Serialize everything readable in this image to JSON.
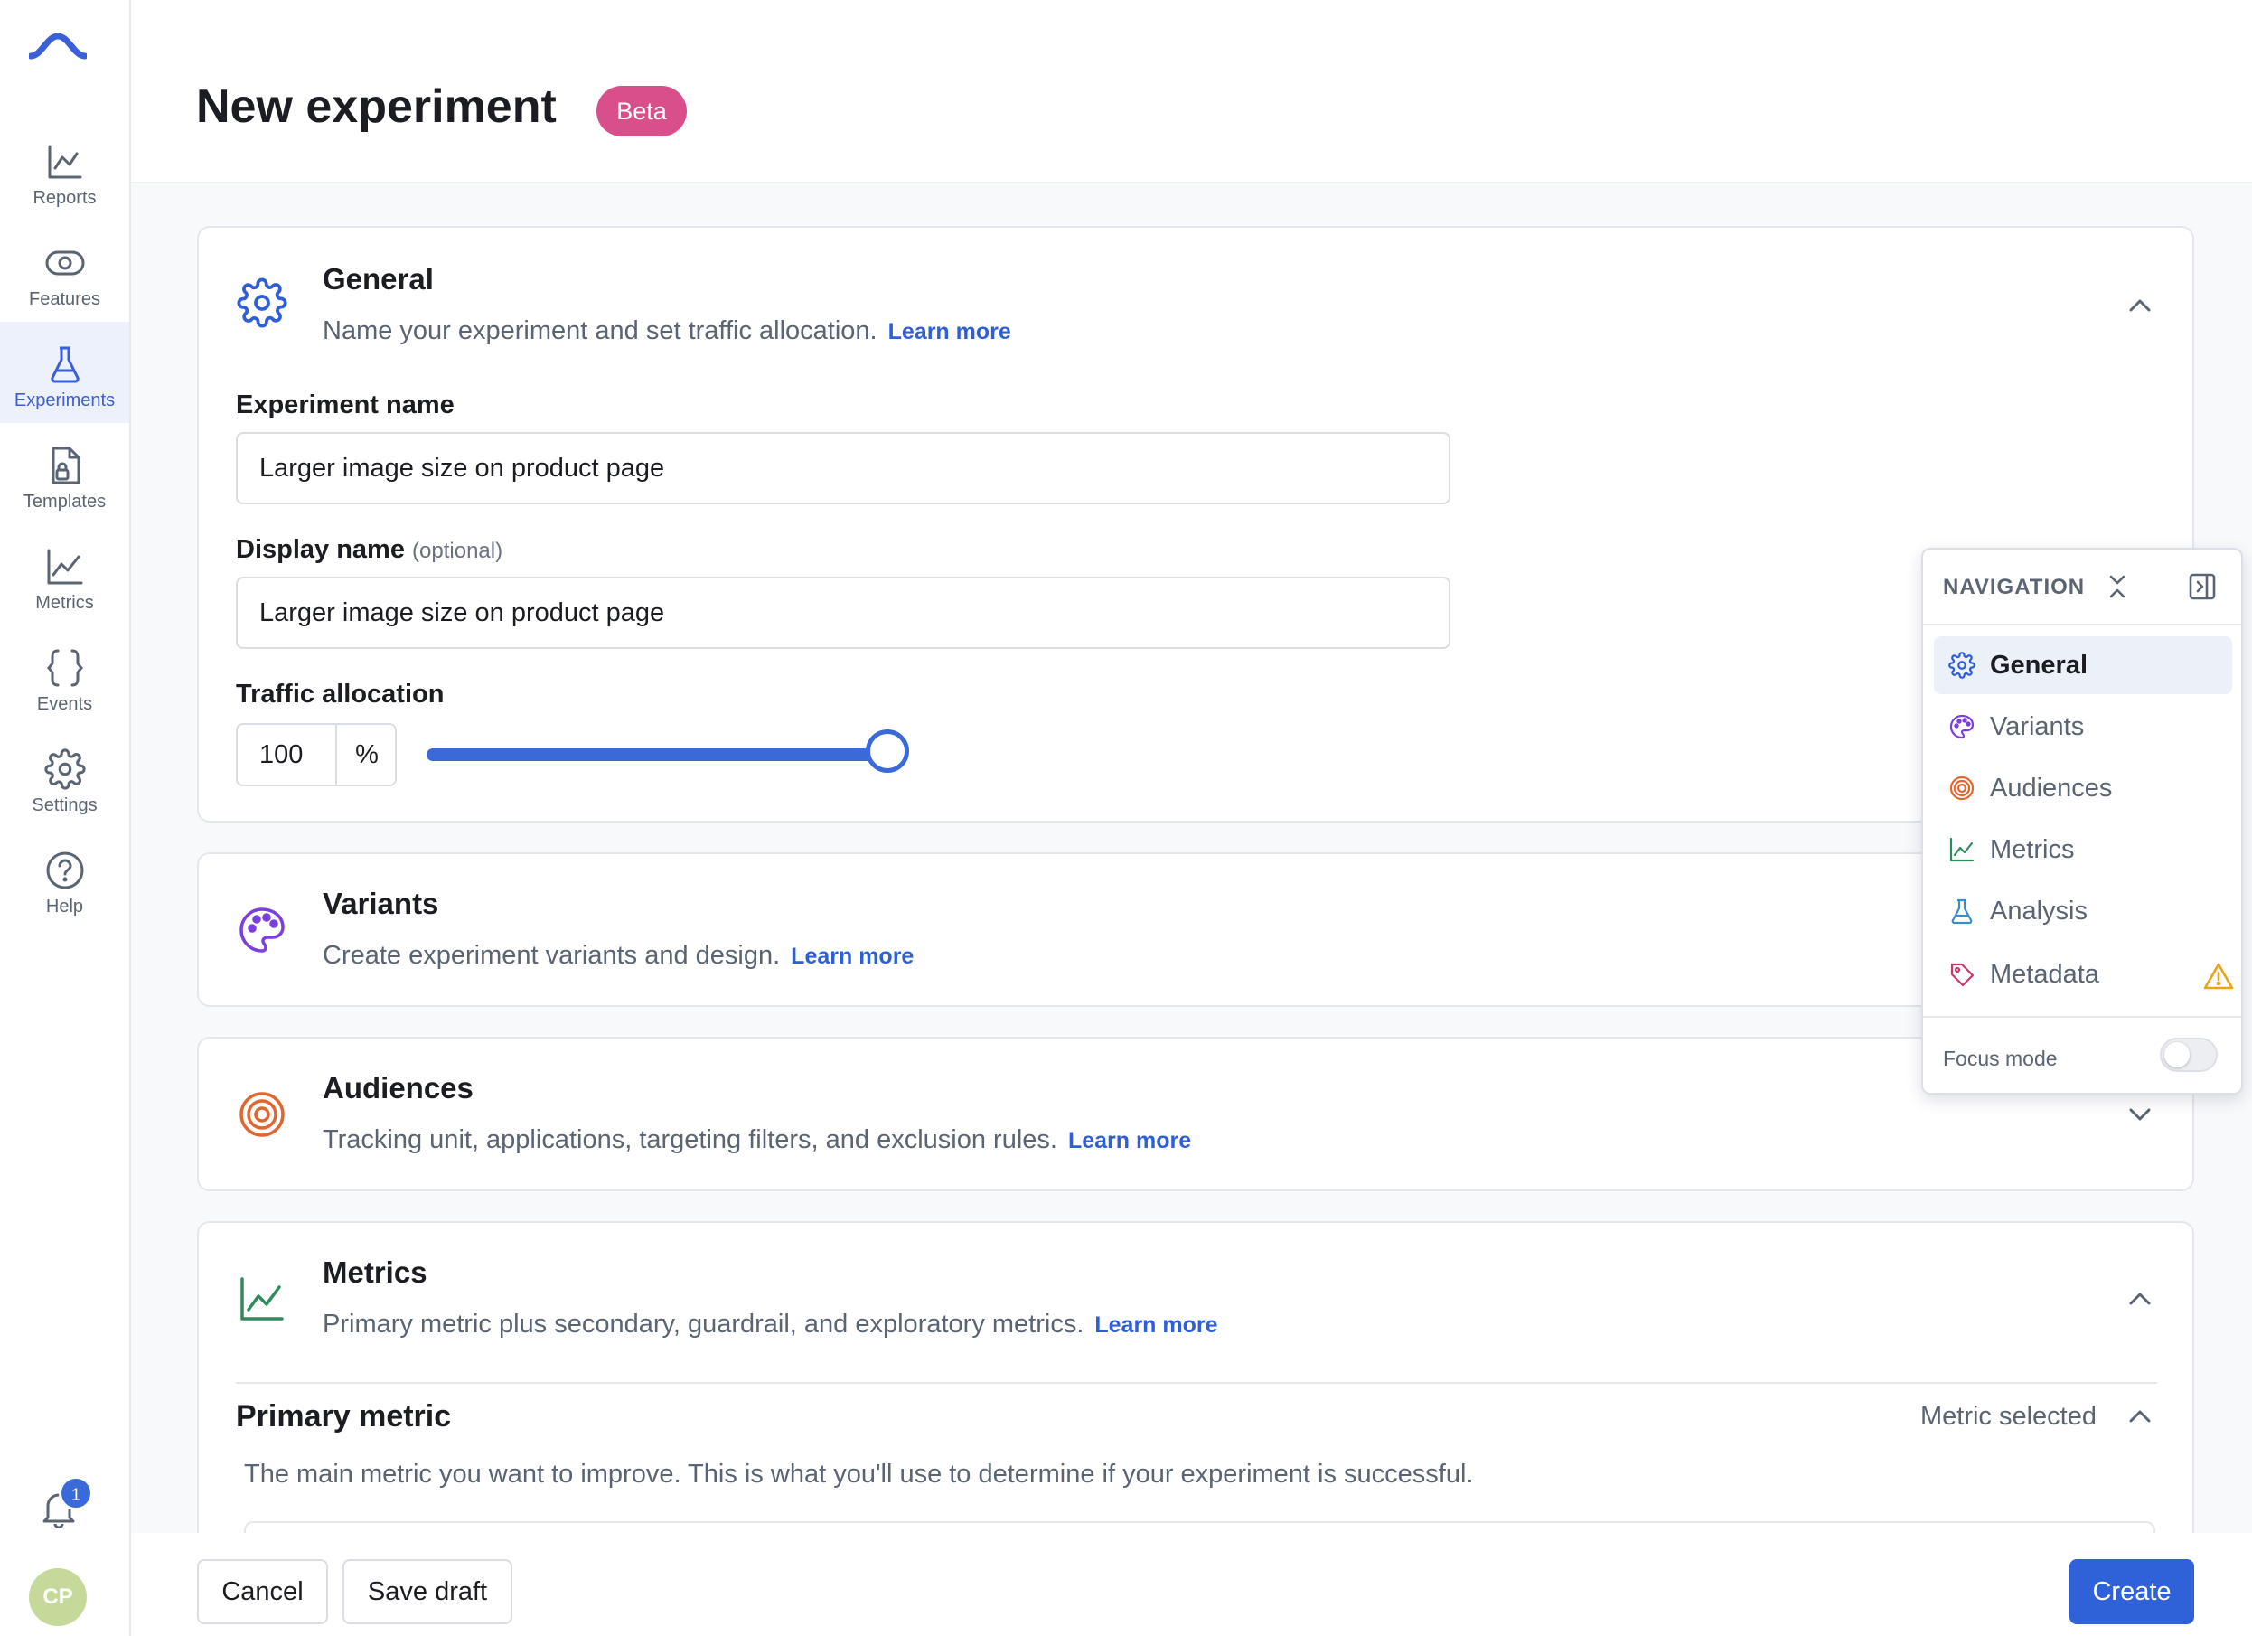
{
  "sidebar": {
    "items": [
      {
        "label": "Reports",
        "icon": "reports-icon"
      },
      {
        "label": "Features",
        "icon": "features-icon"
      },
      {
        "label": "Experiments",
        "icon": "flask-icon",
        "active": true
      },
      {
        "label": "Templates",
        "icon": "templates-icon"
      },
      {
        "label": "Metrics",
        "icon": "metrics-icon"
      },
      {
        "label": "Events",
        "icon": "braces-icon"
      },
      {
        "label": "Settings",
        "icon": "gear-icon"
      },
      {
        "label": "Help",
        "icon": "help-icon"
      }
    ],
    "notification_count": "1",
    "avatar_initials": "CP"
  },
  "header": {
    "title": "New experiment",
    "badge": "Beta"
  },
  "general": {
    "title": "General",
    "description": "Name your experiment and set traffic allocation.",
    "learn_more": "Learn more",
    "experiment_name_label": "Experiment name",
    "experiment_name_value": "Larger image size on product page",
    "display_name_label": "Display name",
    "display_name_optional": "(optional)",
    "display_name_value": "Larger image size on product page",
    "traffic_label": "Traffic allocation",
    "traffic_value": "100",
    "traffic_unit": "%",
    "traffic_fraction": 1.0
  },
  "variants": {
    "title": "Variants",
    "description": "Create experiment variants and design.",
    "learn_more": "Learn more"
  },
  "audiences": {
    "title": "Audiences",
    "description": "Tracking unit, applications, targeting filters, and exclusion rules.",
    "learn_more": "Learn more"
  },
  "metrics": {
    "title": "Metrics",
    "description": "Primary metric plus secondary, guardrail, and exploratory metrics.",
    "learn_more": "Learn more",
    "primary_title": "Primary metric",
    "primary_status": "Metric selected",
    "primary_description": "The main metric you want to improve. This is what you'll use to determine if your experiment is successful."
  },
  "footer": {
    "cancel": "Cancel",
    "save_draft": "Save draft",
    "create": "Create"
  },
  "navigation": {
    "heading": "NAVIGATION",
    "items": [
      {
        "label": "General",
        "icon": "gear-icon",
        "active": true
      },
      {
        "label": "Variants",
        "icon": "palette-icon"
      },
      {
        "label": "Audiences",
        "icon": "target-icon"
      },
      {
        "label": "Metrics",
        "icon": "metrics-icon"
      },
      {
        "label": "Analysis",
        "icon": "flask-icon"
      },
      {
        "label": "Metadata",
        "icon": "tag-icon",
        "warning": true
      }
    ],
    "focus_mode_label": "Focus mode",
    "focus_mode_on": false
  },
  "colors": {
    "accent": "#2f62d8",
    "beta": "#d94f8c",
    "variants": "#7b3fe0",
    "audiences": "#e0662f",
    "metrics": "#2f8a5c",
    "analysis": "#3a8fc8",
    "metadata": "#c83a6a",
    "warning": "#e8a317"
  }
}
